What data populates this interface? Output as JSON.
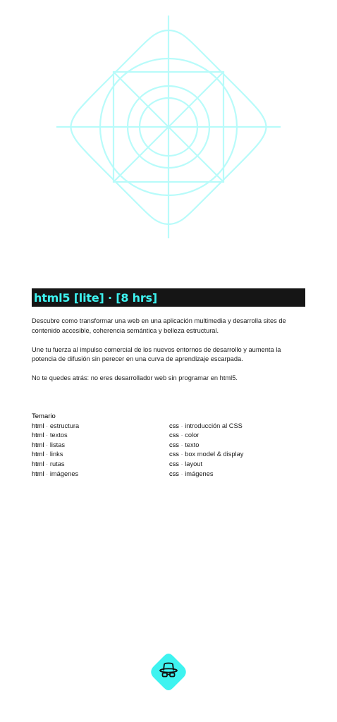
{
  "colors": {
    "accent": "#3ef3f0",
    "hero_stroke": "#b8fbfa",
    "title_bg": "#151515"
  },
  "course": {
    "title": "html5 [lite] · [8 hrs]",
    "paragraphs": [
      "Descubre como transformar una web en una aplicación multimedia y desarrolla sites de contenido accesible, coherencia semántica y belleza estructural.",
      "Une tu fuerza al impulso comercial de los nuevos entornos de desarrollo y aumenta la potencia de difusión sin perecer en una curva de aprendizaje escarpada.",
      "No te quedes atrás: no eres desarrollador web sin programar en html5."
    ]
  },
  "temario": {
    "heading": "Temario",
    "html_items": [
      {
        "prefix": "html",
        "sep": " · ",
        "topic": "estructura"
      },
      {
        "prefix": "html",
        "sep": " · ",
        "topic": "textos"
      },
      {
        "prefix": "html",
        "sep": " · ",
        "topic": "listas"
      },
      {
        "prefix": "html",
        "sep": " · ",
        "topic": "links"
      },
      {
        "prefix": "html",
        "sep": " · ",
        "topic": "rutas"
      },
      {
        "prefix": "html",
        "sep": " · ",
        "topic": "imágenes"
      }
    ],
    "css_items": [
      {
        "prefix": "css",
        "sep": " · ",
        "topic": "introducción al CSS"
      },
      {
        "prefix": "css",
        "sep": " · ",
        "topic": "color"
      },
      {
        "prefix": "css",
        "sep": " · ",
        "topic": "texto"
      },
      {
        "prefix": "css",
        "sep": " · ",
        "topic": "box model & display"
      },
      {
        "prefix": "css",
        "sep": " · ",
        "topic": "layout"
      },
      {
        "prefix": "css",
        "sep": " · ",
        "topic": "imágenes"
      }
    ]
  },
  "icons": {
    "hero": "app-icon-grid-graphic",
    "footer": "incognito-hat-glasses-icon"
  }
}
